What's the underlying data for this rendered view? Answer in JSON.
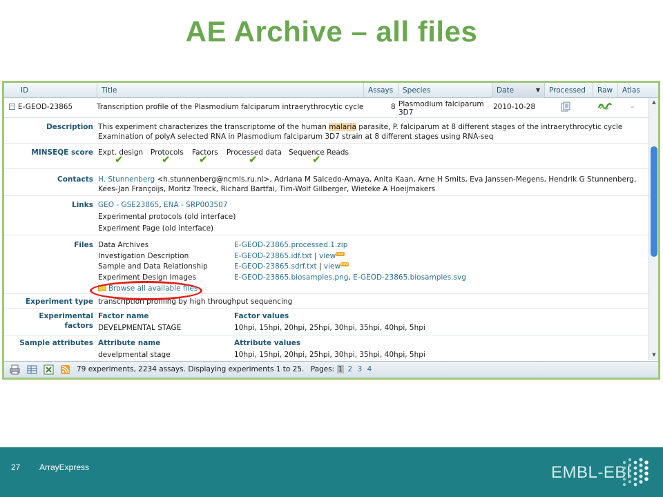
{
  "slide": {
    "title": "AE Archive – all files",
    "page_number": "27",
    "footer_label": "ArrayExpress",
    "logo": "EMBL-EBI"
  },
  "columns": [
    "ID",
    "Title",
    "Assays",
    "Species",
    "Date",
    "Processed",
    "Raw",
    "Atlas"
  ],
  "experiment": {
    "id": "E-GEOD-23865",
    "title": "Transcription profile of the Plasmodium falciparum intraerythrocytic cycle",
    "assays": "8",
    "species_line1": "Plasmodium falciparum",
    "species_line2": "3D7",
    "date": "2010-10-28",
    "atlas": "–"
  },
  "labels": {
    "description": "Description",
    "minseqe": "MINSEQE score",
    "contacts": "Contacts",
    "links": "Links",
    "files": "Files",
    "experiment_type": "Experiment type",
    "experimental_factors_1": "Experimental",
    "experimental_factors_2": "factors",
    "sample_attributes": "Sample attributes"
  },
  "description": {
    "line1_pre": "This experiment characterizes the transcriptome of the human ",
    "line1_highlight": "malaria",
    "line1_post": " parasite, P. falciparum at 8 different stages of the intraerythrocytic cycle",
    "line2": "Examination of polyA selected RNA in Plasmodium falciparum 3D7 strain at 8 different stages using RNA-seq"
  },
  "minseqe": {
    "items": [
      "Expt. design",
      "Protocols",
      "Factors",
      "Processed data",
      "Sequence Reads"
    ],
    "check_icon": "checkmark-icon"
  },
  "contacts": {
    "first_link": "H. Stunnenberg",
    "line1_rest": " <h.stunnenberg@ncmls.ru.nl>, Adriana M Salcedo-Amaya, Anita Kaan, Arne H Smits, Eva Janssen-Megens, Hendrik G Stunnenberg,",
    "line2": "Kees-Jan Françoijs, Moritz Treeck, Richard Bartfai, Tim-Wolf Gilberger, Wieteke A Hoeijmakers"
  },
  "links": {
    "geo": "GEO - GSE23865",
    "sep": ", ",
    "ena": "ENA - SRP003507",
    "protocols": "Experimental protocols (old interface)",
    "page": "Experiment Page (old interface)"
  },
  "files": {
    "rows": [
      {
        "name": "Data Archives",
        "file": "E-GEOD-23865.processed.1.zip"
      },
      {
        "name": "Investigation Description",
        "file": "E-GEOD-23865.idf.txt"
      },
      {
        "name": "Sample and Data Relationship",
        "file": "E-GEOD-23865.sdrf.txt"
      },
      {
        "name": "Experiment Design Images",
        "file": "E-GEOD-23865.biosamples.png",
        "file2": "E-GEOD-23865.biosamples.svg"
      }
    ],
    "separator": " | ",
    "view": "view",
    "new_tag": "new",
    "browse_all": "Browse all available files"
  },
  "experiment_type": "transcription profiling by high throughput sequencing",
  "factors": {
    "name_header": "Factor name",
    "values_header": "Factor values",
    "name": "DEVELPMENTAL STAGE",
    "values": "10hpi, 15hpi, 20hpi, 25hpi, 30hpi, 35hpi, 40hpi, 5hpi"
  },
  "sample_attributes": {
    "name_header": "Attribute name",
    "values_header": "Attribute values",
    "name": "develpmental stage",
    "values": "10hpi, 15hpi, 20hpi, 25hpi, 30hpi, 35hpi, 40hpi, 5hpi"
  },
  "pager": {
    "summary": "79 experiments, 2234 assays. Displaying experiments 1 to 25.",
    "pages_label": "Pages:",
    "pages": [
      "1",
      "2",
      "3",
      "4"
    ]
  },
  "icons": {
    "print": "print-icon",
    "table": "table-icon",
    "excel": "excel-icon",
    "rss": "rss-icon",
    "processed": "processed-data-icon",
    "raw": "raw-data-icon",
    "folder": "folder-icon"
  },
  "colors": {
    "title_green": "#6aa84f",
    "bar_teal": "#1f7f87",
    "link_blue": "#2a6f8f",
    "annotation_red": "#e0201b"
  }
}
